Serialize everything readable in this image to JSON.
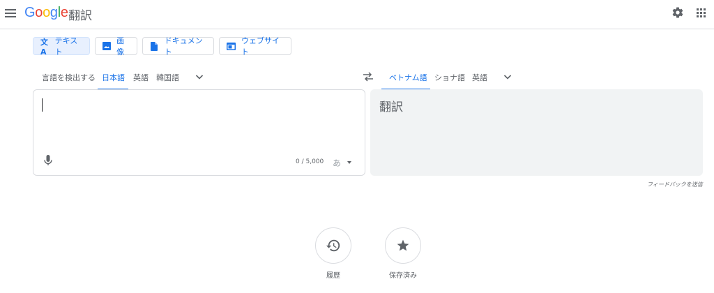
{
  "header": {
    "logo": [
      "G",
      "o",
      "o",
      "g",
      "l",
      "e"
    ],
    "title": "翻訳"
  },
  "modes": [
    {
      "label": "テキスト",
      "icon": "translate-icon",
      "active": true
    },
    {
      "label": "画像",
      "icon": "image-icon",
      "active": false
    },
    {
      "label": "ドキュメント",
      "icon": "document-icon",
      "active": false
    },
    {
      "label": "ウェブサイト",
      "icon": "website-icon",
      "active": false
    }
  ],
  "source_langs": [
    "言語を検出する",
    "日本語",
    "英語",
    "韓国語"
  ],
  "source_active": "日本語",
  "target_langs": [
    "ベトナム語",
    "ショナ語",
    "英語"
  ],
  "target_active": "ベトナム語",
  "source": {
    "value": "",
    "char_count": "0 / 5,000",
    "ime": "あ"
  },
  "target": {
    "placeholder": "翻訳"
  },
  "feedback": "フィードバックを送信",
  "bottom": {
    "history": "履歴",
    "saved": "保存済み"
  },
  "colors": {
    "accent": "#1a73e8",
    "active_bg": "#e8f0fe",
    "panel_bg": "#f1f3f4",
    "border": "#dadce0"
  }
}
